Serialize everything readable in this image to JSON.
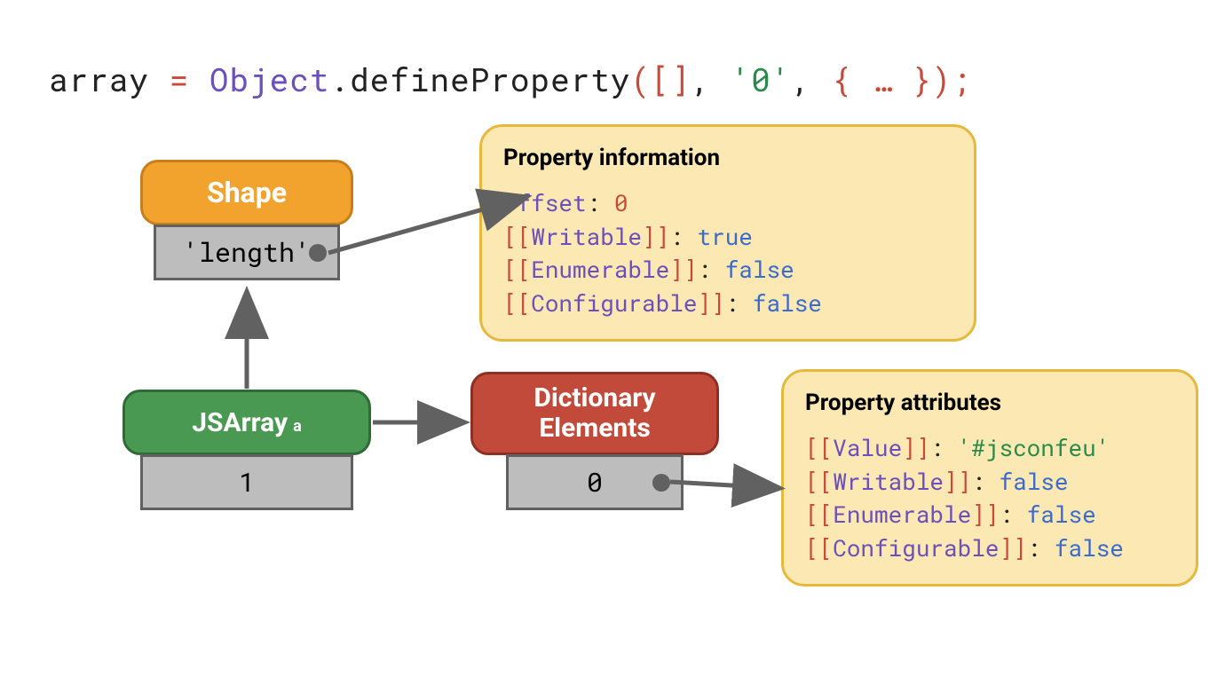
{
  "code": {
    "array": "array",
    "eq": " = ",
    "object": "Object",
    "dot": ".",
    "method": "defineProperty",
    "lp": "(",
    "arg1": "[]",
    "c1": ", ",
    "arg2": "'0'",
    "c2": ", ",
    "arg3": "{ … }",
    "rp": ");"
  },
  "shape": {
    "label": "Shape",
    "cell": "'length'"
  },
  "jsarray": {
    "label": "JSArray",
    "sublabel": "a",
    "cell": "1"
  },
  "dict": {
    "label_l1": "Dictionary",
    "label_l2": "Elements",
    "cell": "0"
  },
  "propInfo": {
    "title": "Property information",
    "offset_k": "Offset",
    "offset_v": "0",
    "writable_k": "Writable",
    "writable_v": "true",
    "enumerable_k": "Enumerable",
    "enumerable_v": "false",
    "configurable_k": "Configurable",
    "configurable_v": "false"
  },
  "propAttr": {
    "title": "Property attributes",
    "value_k": "Value",
    "value_v": "'#jsconfeu'",
    "writable_k": "Writable",
    "writable_v": "false",
    "enumerable_k": "Enumerable",
    "enumerable_v": "false",
    "configurable_k": "Configurable",
    "configurable_v": "false"
  }
}
